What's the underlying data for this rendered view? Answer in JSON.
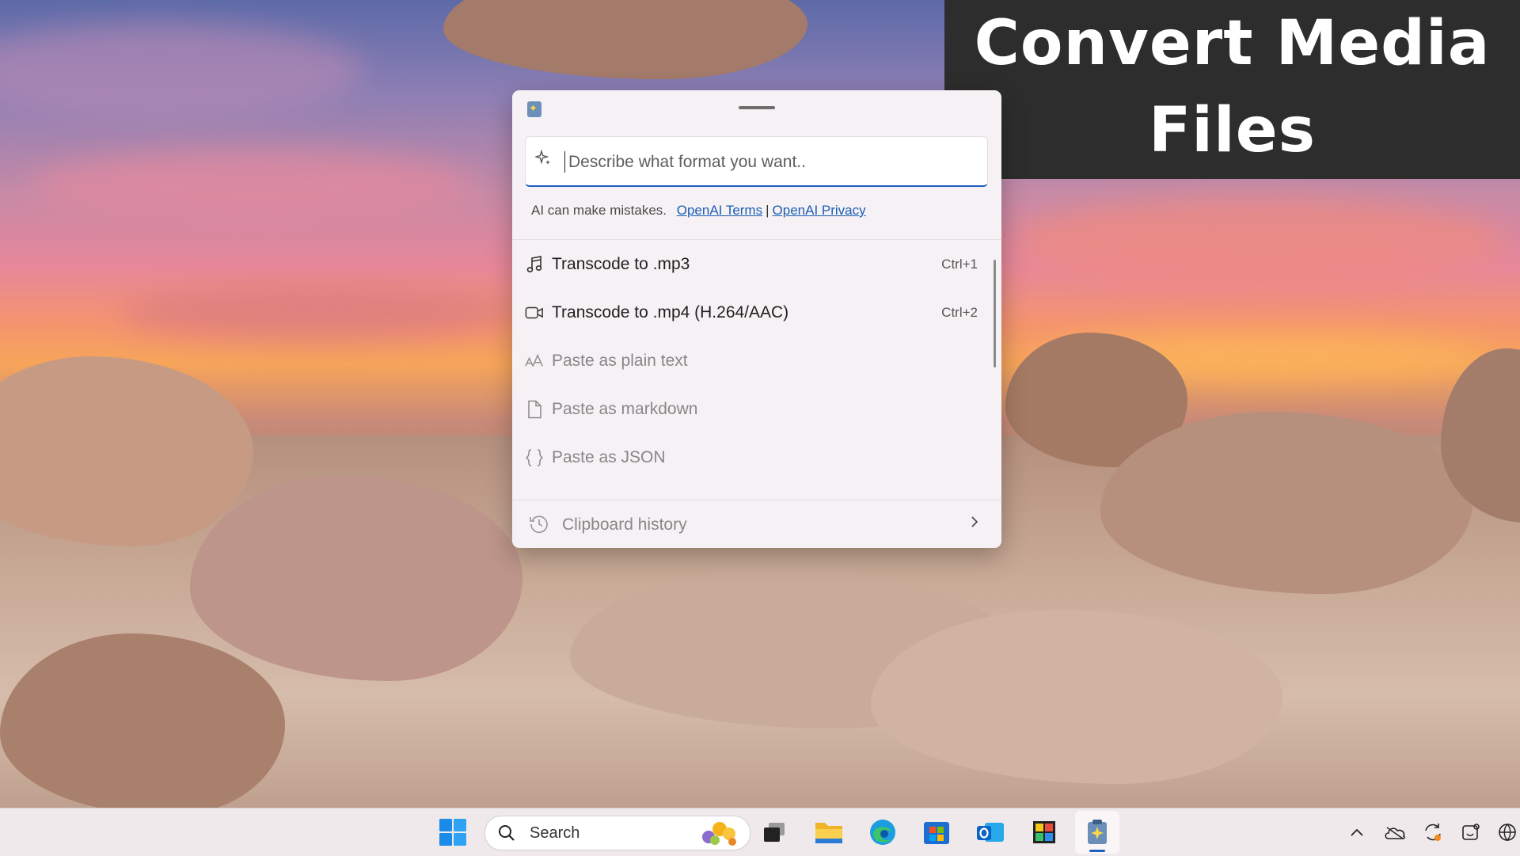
{
  "banner": {
    "line1": "Convert Media",
    "line2": "Files"
  },
  "paste_window": {
    "prompt_placeholder": "Describe what format you want..",
    "disclaimer": "AI can make mistakes.",
    "terms_link": "OpenAI Terms",
    "separator": "|",
    "privacy_link": "OpenAI Privacy",
    "actions": [
      {
        "label": "Transcode to .mp3",
        "shortcut": "Ctrl+1",
        "icon": "music-note-icon",
        "enabled": true
      },
      {
        "label": "Transcode to .mp4 (H.264/AAC)",
        "shortcut": "Ctrl+2",
        "icon": "video-camera-icon",
        "enabled": true
      },
      {
        "label": "Paste as plain text",
        "shortcut": "",
        "icon": "text-font-icon",
        "enabled": false
      },
      {
        "label": "Paste as markdown",
        "shortcut": "",
        "icon": "document-icon",
        "enabled": false
      },
      {
        "label": "Paste as JSON",
        "shortcut": "",
        "icon": "braces-icon",
        "enabled": false
      }
    ],
    "history_label": "Clipboard history"
  },
  "taskbar": {
    "search_label": "Search",
    "apps": [
      "windows-start-icon",
      "task-view-icon",
      "file-explorer-icon",
      "edge-icon",
      "store-icon",
      "outlook-icon",
      "color-picker-icon",
      "advanced-paste-icon"
    ],
    "tray": [
      "chevron-up-icon",
      "onedrive-icon",
      "sync-icon",
      "notification-icon",
      "language-icon"
    ]
  }
}
